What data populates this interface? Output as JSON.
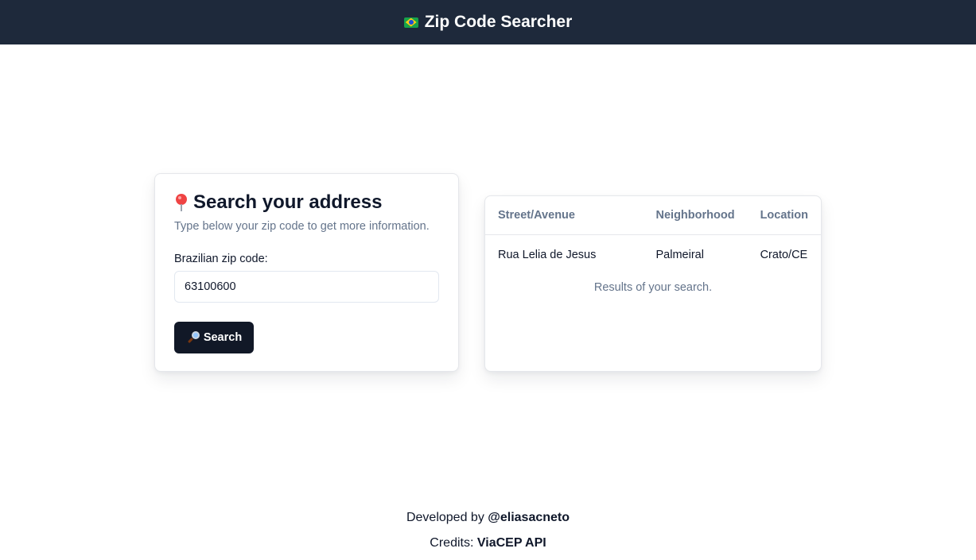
{
  "header": {
    "title": "Zip Code Searcher",
    "flag_icon": "brazil-flag-icon"
  },
  "search": {
    "title": "Search your address",
    "title_icon": "pin-icon",
    "subtitle": "Type below your zip code to get more information.",
    "field_label": "Brazilian zip code:",
    "input_value": "63100600",
    "button_label": "Search",
    "button_icon": "magnifier-icon"
  },
  "results": {
    "headers": [
      "Street/Avenue",
      "Neighborhood",
      "Location"
    ],
    "rows": [
      [
        "Rua Lelia de Jesus",
        "Palmeiral",
        "Crato/CE"
      ]
    ],
    "caption": "Results of your search."
  },
  "footer": {
    "developed_prefix": "Developed by",
    "developer_handle": "@eliasacneto",
    "credits_prefix": "Credits:",
    "credits_source": "ViaCEP API"
  },
  "colors": {
    "header_bg": "#1e293b",
    "button_bg": "#111827",
    "muted_text": "#64748b"
  }
}
